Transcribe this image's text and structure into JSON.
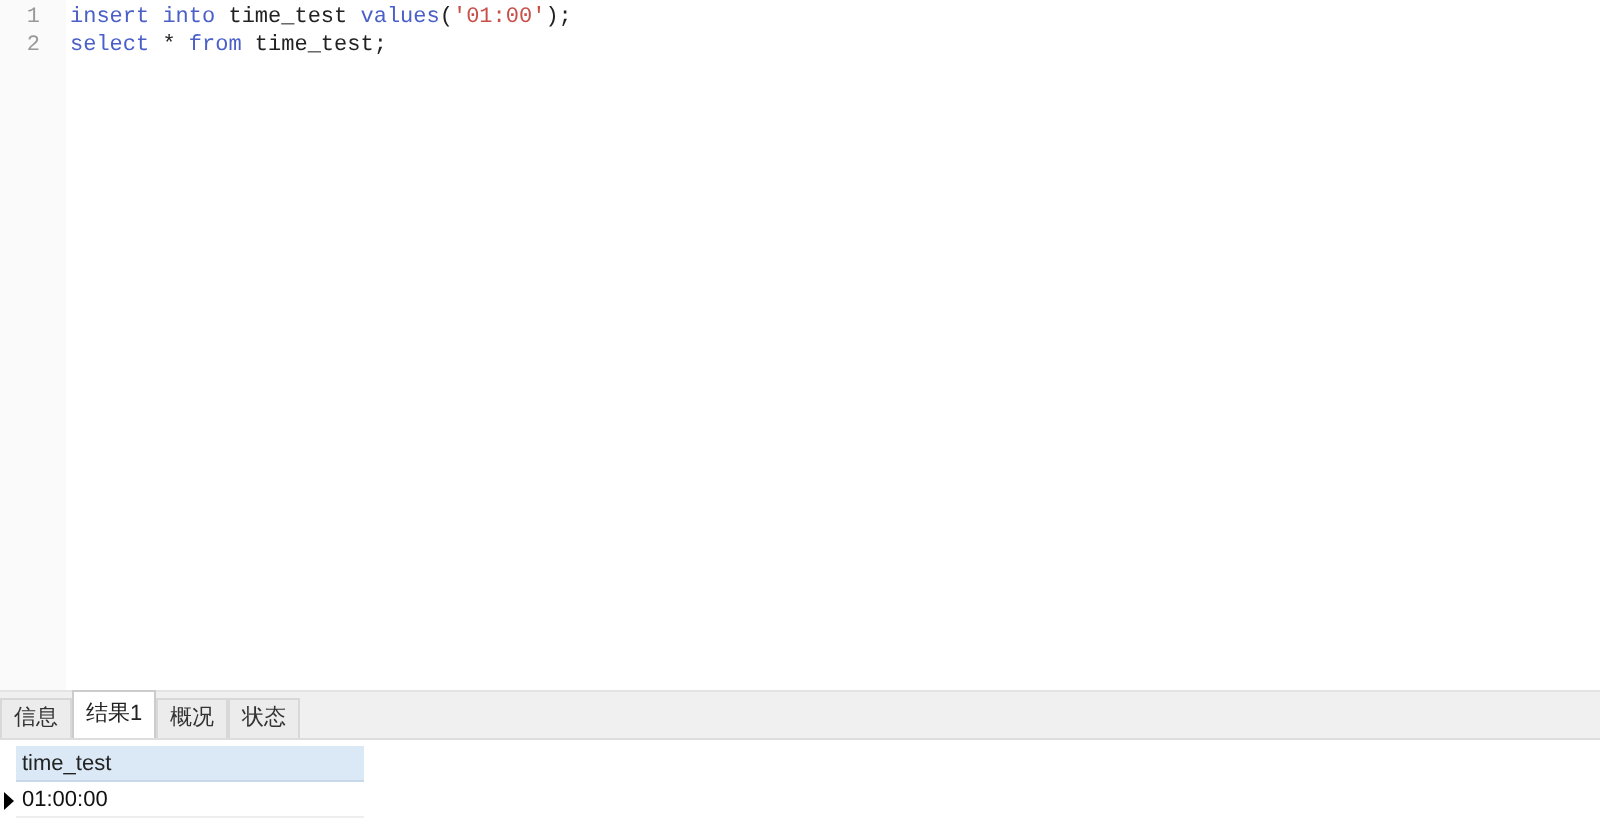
{
  "editor": {
    "lines": [
      {
        "number": "1",
        "tokens": [
          {
            "kind": "keyword",
            "text": "insert into"
          },
          {
            "kind": "plain",
            "text": " time_test "
          },
          {
            "kind": "keyword",
            "text": "values"
          },
          {
            "kind": "plain",
            "text": "("
          },
          {
            "kind": "string",
            "text": "'01:00'"
          },
          {
            "kind": "plain",
            "text": ");"
          }
        ]
      },
      {
        "number": "2",
        "tokens": [
          {
            "kind": "keyword",
            "text": "select"
          },
          {
            "kind": "plain",
            "text": " * "
          },
          {
            "kind": "keyword",
            "text": "from"
          },
          {
            "kind": "plain",
            "text": " time_test;"
          }
        ]
      }
    ]
  },
  "tabs": [
    {
      "label": "信息",
      "selected": false
    },
    {
      "label": "结果1",
      "selected": true
    },
    {
      "label": "概况",
      "selected": false
    },
    {
      "label": "状态",
      "selected": false
    }
  ],
  "table": {
    "columns": [
      "time_test"
    ],
    "rows": [
      {
        "current": true,
        "cells": [
          "01:00:00"
        ]
      }
    ]
  }
}
